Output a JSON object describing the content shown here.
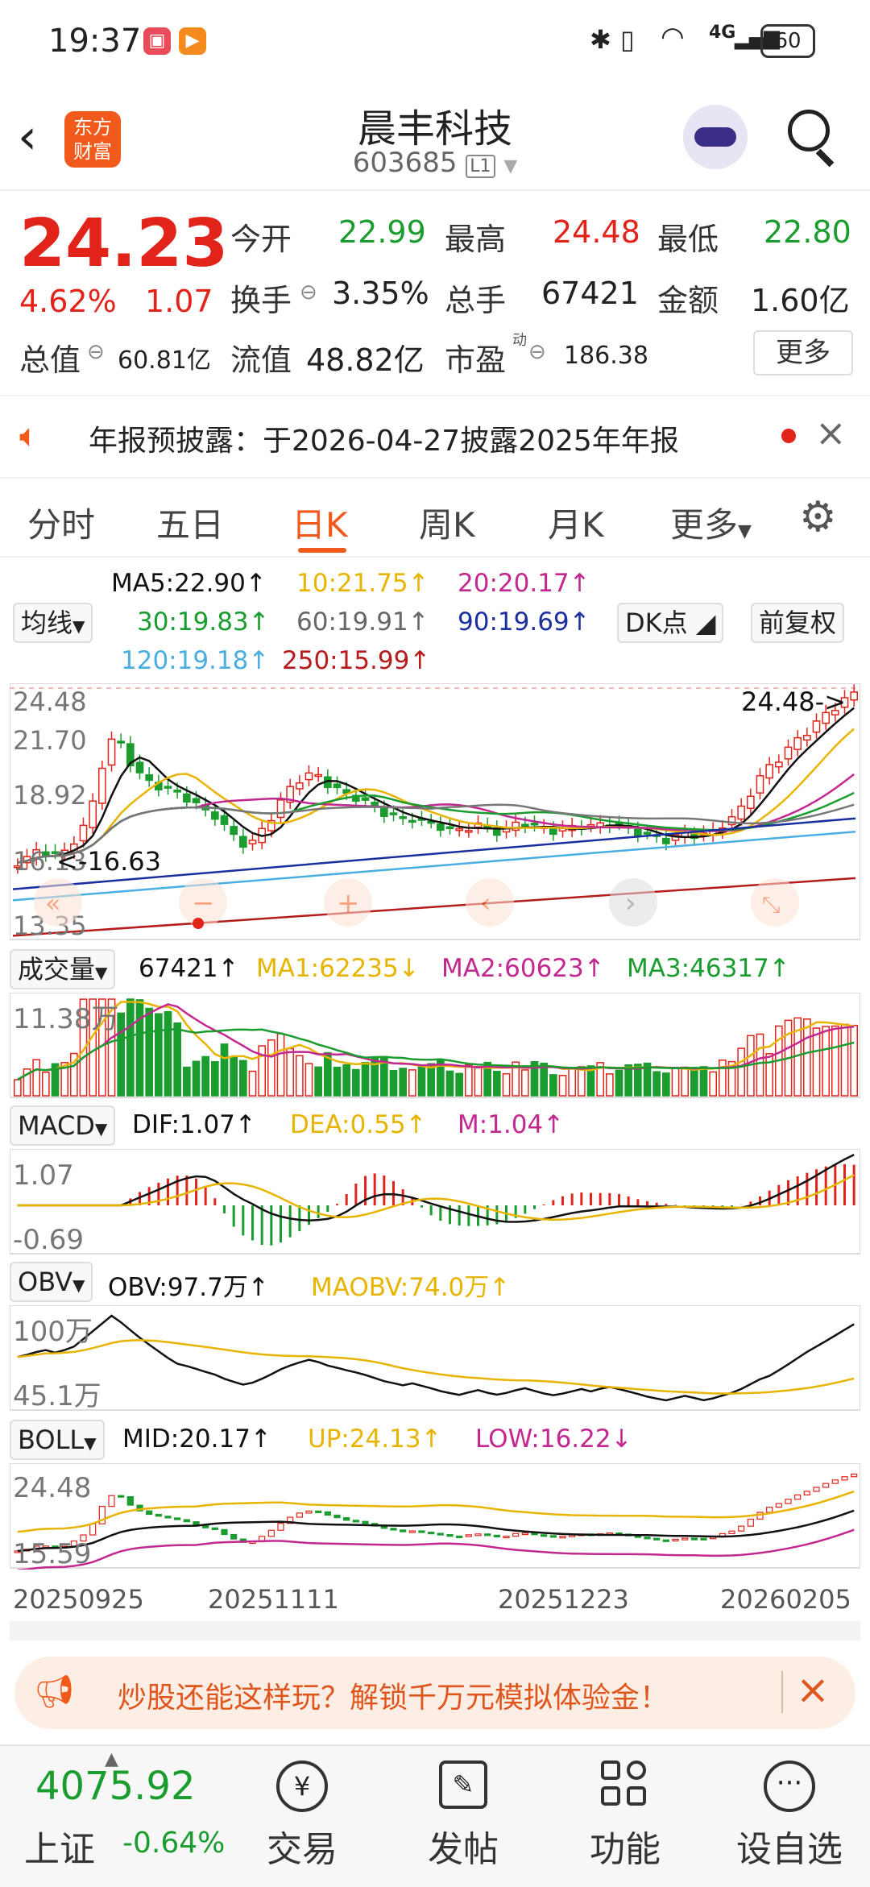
{
  "status_bar": {
    "time": "19:37",
    "battery": "60",
    "network": "4G"
  },
  "header": {
    "title": "晨丰科技",
    "code": "603685",
    "code_tag": "L1",
    "logo_text": "东方财富"
  },
  "quote": {
    "price": "24.23",
    "change_pct": "4.62%",
    "change": "1.07",
    "open_label": "今开",
    "open": "22.99",
    "high_label": "最高",
    "high": "24.48",
    "low_label": "最低",
    "low": "22.80",
    "turnover_label": "换手",
    "turnover": "3.35%",
    "volume_label": "总手",
    "volume": "67421",
    "amount_label": "金额",
    "amount": "1.60亿",
    "mcap_label": "总值",
    "mcap": "60.81亿",
    "float_label": "流值",
    "float": "48.82亿",
    "pe_label": "市盈",
    "pe_sup": "动",
    "pe": "186.38",
    "more": "更多"
  },
  "notice": {
    "text": "年报预披露：于2026-04-27披露2025年年报"
  },
  "tabs": [
    "分时",
    "五日",
    "日K",
    "周K",
    "月K",
    "更多"
  ],
  "active_tab": "日K",
  "ma": {
    "selector": "均线",
    "ma5": "MA5:22.90↑",
    "ma10": "10:21.75↑",
    "ma20": "20:20.17↑",
    "ma30": "30:19.83↑",
    "ma60": "60:19.91↑",
    "ma90": "90:19.69↑",
    "ma120": "120:19.18↑",
    "ma250": "250:15.99↑",
    "dk_button": "DK点",
    "adjust_button": "前复权"
  },
  "kline": {
    "y_labels": [
      "24.48",
      "21.70",
      "18.92",
      "16.13",
      "13.35"
    ],
    "high_mark": "24.48->",
    "low_mark": "<-16.63"
  },
  "volume_ind": {
    "selector": "成交量",
    "value": "67421↑",
    "ma1": "MA1:62235↓",
    "ma2": "MA2:60623↑",
    "ma3": "MA3:46317↑",
    "y_label": "11.38万"
  },
  "macd_ind": {
    "selector": "MACD",
    "dif": "DIF:1.07↑",
    "dea": "DEA:0.55↑",
    "m": "M:1.04↑",
    "y_top": "1.07",
    "y_bottom": "-0.69"
  },
  "obv_ind": {
    "selector": "OBV",
    "obv": "OBV:97.7万↑",
    "maobv": "MAOBV:74.0万↑",
    "y_top": "100万",
    "y_bottom": "45.1万"
  },
  "boll_ind": {
    "selector": "BOLL",
    "mid": "MID:20.17↑",
    "up": "UP:24.13↑",
    "low": "LOW:16.22↓",
    "y_top": "24.48",
    "y_bottom": "15.59"
  },
  "dates": [
    "20250925",
    "20251111",
    "20251223",
    "20260205"
  ],
  "ad": {
    "text": "炒股还能这样玩？解锁千万元模拟体验金！"
  },
  "index": {
    "value": "4075.92",
    "name": "上证",
    "change": "-0.64%"
  },
  "nav": [
    "交易",
    "发帖",
    "功能",
    "设自选"
  ],
  "colors": {
    "up": "#e2231a",
    "down": "#1a9c2e",
    "accent": "#f25a1c",
    "ma5": "#111111",
    "ma10": "#e8b400",
    "ma20": "#c2288f",
    "ma30": "#1a9c2e",
    "ma60": "#777777",
    "ma90": "#1a2fa0",
    "ma120": "#4aaee0",
    "ma250": "#b71c1c"
  }
}
